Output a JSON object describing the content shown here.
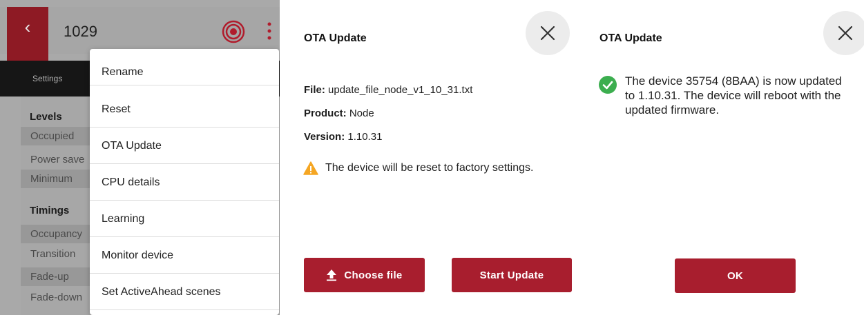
{
  "device_screen": {
    "title": "1029",
    "tab_label": "Settings",
    "sections": [
      {
        "heading": "Levels",
        "rows": [
          "Occupied",
          "Power save",
          "Minimum"
        ]
      },
      {
        "heading": "Timings",
        "rows": [
          "Occupancy",
          "Transition",
          "Fade-up",
          "Fade-down"
        ]
      }
    ],
    "menu": {
      "items": [
        "Rename",
        "Reset",
        "OTA Update",
        "CPU details",
        "Learning",
        "Monitor device",
        "Set ActiveAhead scenes"
      ]
    },
    "icons": {
      "back": "chevron-left-icon",
      "target": "target-icon",
      "more": "more-vert-icon"
    },
    "colors": {
      "accent": "#8e1a24"
    }
  },
  "ota_dialog": {
    "title": "OTA Update",
    "file_label": "File:",
    "file_value": "update_file_node_v1_10_31.txt",
    "product_label": "Product:",
    "product_value": "Node",
    "version_label": "Version:",
    "version_value": "1.10.31",
    "warning": "The device will be reset to factory settings.",
    "choose_file_label": "Choose file",
    "start_update_label": "Start Update",
    "colors": {
      "button": "#a81e2e",
      "warning": "#f5a623"
    }
  },
  "success_dialog": {
    "title": "OTA Update",
    "message": "The device 35754 (8BAA) is now updated to 1.10.31. The device will reboot with the updated firmware.",
    "ok_label": "OK",
    "colors": {
      "success": "#3cae4f"
    }
  }
}
